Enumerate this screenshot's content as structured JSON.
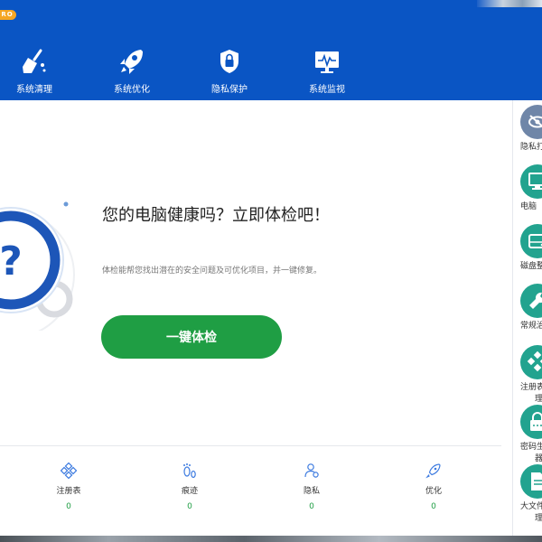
{
  "header": {
    "badge": "PRO",
    "nav": [
      {
        "label": "系统清理",
        "icon": "broom-icon"
      },
      {
        "label": "系统优化",
        "icon": "rocket-icon"
      },
      {
        "label": "隐私保护",
        "icon": "shield-lock-icon"
      },
      {
        "label": "系统监视",
        "icon": "monitor-pulse-icon"
      }
    ]
  },
  "main": {
    "headline": "您的电脑健康吗？立即体检吧！",
    "description": "体检能帮您找出潜在的安全问题及可优化项目，并一键修复。",
    "check_button": "一键体检",
    "status_glyph": "?",
    "stats": [
      {
        "label": "注册表",
        "value": "0",
        "icon": "registry-icon"
      },
      {
        "label": "痕迹",
        "value": "0",
        "icon": "footprint-icon"
      },
      {
        "label": "隐私",
        "value": "0",
        "icon": "user-privacy-icon"
      },
      {
        "label": "优化",
        "value": "0",
        "icon": "rocket-small-icon"
      }
    ]
  },
  "sidebar": {
    "tools": [
      {
        "label": "隐私打",
        "label2": "",
        "color": "#6f86a8",
        "icon": "eye-slash-icon"
      },
      {
        "label": "电脑",
        "label2": "",
        "color": "#22a38f",
        "icon": "computer-icon"
      },
      {
        "label": "磁盘整",
        "label2": "",
        "color": "#22a38f",
        "icon": "disk-icon"
      },
      {
        "label": "常规治",
        "label2": "",
        "color": "#22a38f",
        "icon": "wrench-icon"
      },
      {
        "label": "注册表",
        "label2": "理",
        "color": "#22a38f",
        "icon": "registry-tool-icon"
      },
      {
        "label": "密码生",
        "label2": "器",
        "color": "#22a38f",
        "icon": "password-icon"
      },
      {
        "label": "大文件",
        "label2": "理",
        "color": "#22a38f",
        "icon": "large-file-icon"
      }
    ]
  },
  "colors": {
    "header_blue": "#0a55c4",
    "accent_green": "#1f9e44",
    "ring_blue": "#1d56b8",
    "tool_teal": "#22a38f",
    "badge_orange": "#f5a623"
  }
}
